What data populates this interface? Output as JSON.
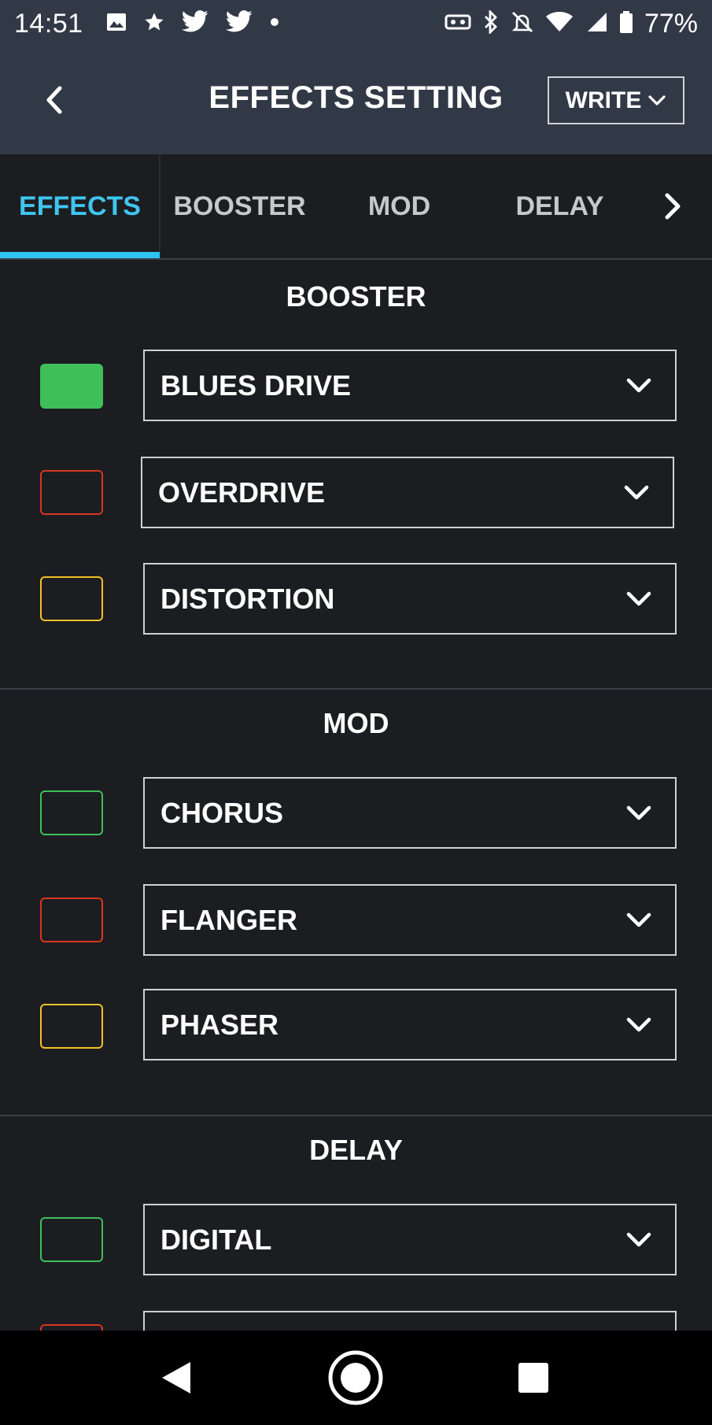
{
  "status_bar": {
    "time": "14:51",
    "battery_pct": "77%",
    "left_icons": [
      "image-icon",
      "star-icon",
      "twitter-icon",
      "twitter-icon",
      "dot-icon"
    ],
    "right_icons": [
      "vr-headset-icon",
      "bluetooth-icon",
      "bell-off-icon",
      "wifi-icon",
      "cellular-signal-icon",
      "battery-icon"
    ]
  },
  "header": {
    "title": "EFFECTS SETTING",
    "write_label": "WRITE"
  },
  "tabs": [
    {
      "label": "EFFECTS",
      "active": true
    },
    {
      "label": "BOOSTER",
      "active": false
    },
    {
      "label": "MOD",
      "active": false
    },
    {
      "label": "DELAY",
      "active": false
    }
  ],
  "sections": [
    {
      "title": "BOOSTER",
      "rows": [
        {
          "swatch_color": "#3fbf5a",
          "filled": true,
          "value": "BLUES DRIVE"
        },
        {
          "swatch_color": "#d8361f",
          "filled": false,
          "value": "OVERDRIVE"
        },
        {
          "swatch_color": "#f2c02a",
          "filled": false,
          "value": "DISTORTION"
        }
      ]
    },
    {
      "title": "MOD",
      "rows": [
        {
          "swatch_color": "#3fbf5a",
          "filled": false,
          "value": "CHORUS"
        },
        {
          "swatch_color": "#d8361f",
          "filled": false,
          "value": "FLANGER"
        },
        {
          "swatch_color": "#f2c02a",
          "filled": false,
          "value": "PHASER"
        }
      ]
    },
    {
      "title": "DELAY",
      "rows": [
        {
          "swatch_color": "#3fbf5a",
          "filled": false,
          "value": "DIGITAL"
        },
        {
          "swatch_color": "#d8361f",
          "filled": false,
          "value": ""
        }
      ]
    }
  ],
  "colors": {
    "accent": "#2cc3f0",
    "header_bg": "#323946",
    "page_bg": "#1c1d21"
  }
}
